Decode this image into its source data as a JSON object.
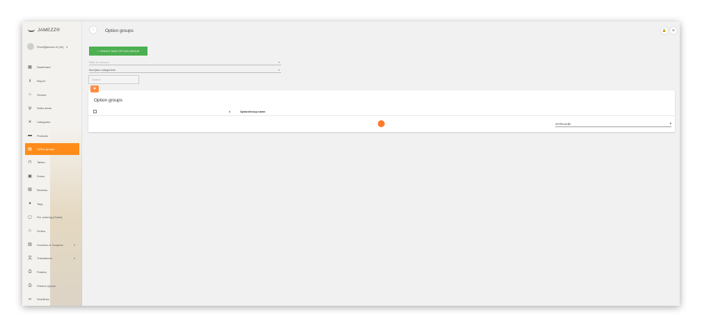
{
  "app": {
    "logo_text": "JAMEZZ®"
  },
  "user": {
    "email": "Floor@jamezz.nl (34)",
    "caret": "▾"
  },
  "sidebar": {
    "items": [
      {
        "key": "dashboard",
        "label": "Dashboard",
        "icon": "dashboard-icon",
        "glyph": "▦"
      },
      {
        "key": "report",
        "label": "Report",
        "icon": "bar-chart-icon",
        "glyph": "ıl"
      },
      {
        "key": "venues",
        "label": "Venues",
        "icon": "home-icon",
        "glyph": "⌂"
      },
      {
        "key": "sales-areas",
        "label": "Sales areas",
        "icon": "fork-knife-icon",
        "glyph": "ψ"
      },
      {
        "key": "categories",
        "label": "Categories",
        "icon": "utensils-cross-icon",
        "glyph": "✕"
      },
      {
        "key": "products",
        "label": "Products",
        "icon": "product-icon",
        "glyph": "▬"
      },
      {
        "key": "option-groups",
        "label": "Option groups",
        "icon": "option-groups-icon",
        "glyph": "▤",
        "active": true
      },
      {
        "key": "tables",
        "label": "Tables",
        "icon": "tables-icon",
        "glyph": "⊓"
      },
      {
        "key": "zones",
        "label": "Zones",
        "icon": "zones-icon",
        "glyph": "▣"
      },
      {
        "key": "reviews",
        "label": "Reviews",
        "icon": "reviews-icon",
        "glyph": "▧"
      },
      {
        "key": "tags",
        "label": "Tags",
        "icon": "tag-icon",
        "glyph": "●"
      },
      {
        "key": "pre-ordering",
        "label": "Pre ordering (Guest)",
        "icon": "calendar-icon",
        "glyph": "▢"
      },
      {
        "key": "orders",
        "label": "Orders",
        "icon": "orders-icon",
        "glyph": "♨"
      },
      {
        "key": "vouchers",
        "label": "Vouchers & Coupons",
        "icon": "voucher-icon",
        "glyph": "▥",
        "chevron": "▾"
      },
      {
        "key": "translations",
        "label": "Translations",
        "icon": "translate-icon",
        "glyph": "文",
        "chevron": "▾"
      },
      {
        "key": "printers",
        "label": "Printers",
        "icon": "printer-icon",
        "glyph": "⎙"
      },
      {
        "key": "printers-queue",
        "label": "Printers Queue",
        "icon": "printer-queue-icon",
        "glyph": "⎙"
      },
      {
        "key": "shortlinks",
        "label": "Shortlinks",
        "icon": "link-icon",
        "glyph": "∞"
      }
    ]
  },
  "header": {
    "title": "Option groups",
    "back_glyph": "‹",
    "lock_glyph": "🔒",
    "zoom_glyph": "⊕"
  },
  "toolbar": {
    "create_label": "+ CREATE NEW OPTION GROUP"
  },
  "filters": {
    "venue_placeholder": "Filter on venues",
    "sort_value": "floor/jaco categorieen",
    "caret": "▾",
    "search_placeholder": "Search"
  },
  "favorite": {
    "glyph": "♥"
  },
  "table": {
    "title": "Option groups",
    "col_hash": "#",
    "col_name": "OptionGroup name",
    "records_value": "10 Records",
    "records_caret": "▾"
  },
  "colors": {
    "accent": "#ff8c1a",
    "create_button": "#4caf50",
    "loader": "#ff7a2e"
  }
}
